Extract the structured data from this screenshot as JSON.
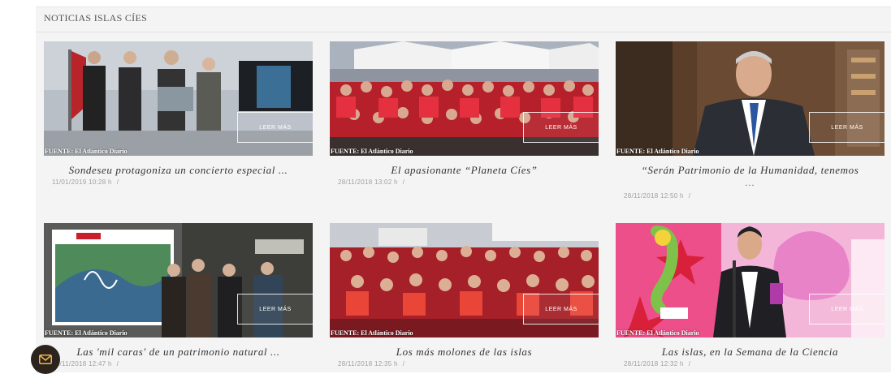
{
  "section": {
    "title": "NOTICIAS ISLAS CÍES"
  },
  "colors": {
    "accent": "#2b241e",
    "panel": "#f4f4f4"
  },
  "icons": {
    "chat": "envelope-icon"
  },
  "cards": [
    {
      "title": "Sondeseu protagoniza un concierto especial ...",
      "date": "11/01/2019 10:28 h",
      "read_more": "LEER MÁS",
      "source": "FUENTE: El Atlántico Diario"
    },
    {
      "title": "El apasionante “Planeta Cíes”",
      "date": "28/11/2018 13:02 h",
      "read_more": "LEER MÁS",
      "source": "FUENTE: El Atlántico Diario"
    },
    {
      "title": "“Serán Patrimonio de la Humanidad, tenemos",
      "title_ellipsis": "...",
      "date": "28/11/2018 12:50 h",
      "read_more": "LEER MÁS",
      "source": "FUENTE: El Atlántico Diario"
    },
    {
      "title": "Las 'mil caras' de un patrimonio natural ...",
      "date": "28/11/2018 12:47 h",
      "read_more": "LEER MÁS",
      "source": "FUENTE: El Atlántico Diario"
    },
    {
      "title": "Los más molones de las islas",
      "date": "28/11/2018 12:35 h",
      "read_more": "LEER MÁS",
      "source": "FUENTE: El Atlántico Diario"
    },
    {
      "title": "Las islas, en la Semana de la Ciencia",
      "date": "28/11/2018 12:32 h",
      "read_more": "LEER MÁS",
      "source": "FUENTE: El Atlántico Diario"
    }
  ]
}
